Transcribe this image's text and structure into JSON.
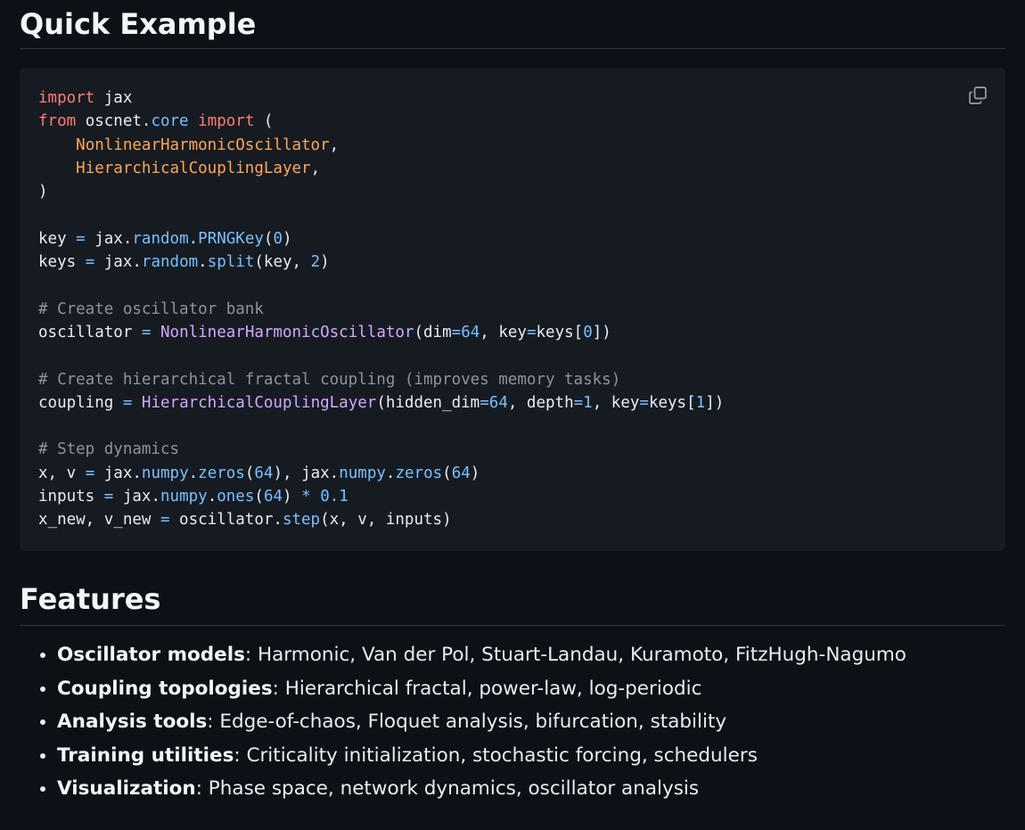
{
  "headings": {
    "quick_example": "Quick Example",
    "features": "Features"
  },
  "code": {
    "language": "python",
    "lines": [
      "import jax",
      "from oscnet.core import (",
      "    NonlinearHarmonicOscillator,",
      "    HierarchicalCouplingLayer,",
      ")",
      "",
      "key = jax.random.PRNGKey(0)",
      "keys = jax.random.split(key, 2)",
      "",
      "# Create oscillator bank",
      "oscillator = NonlinearHarmonicOscillator(dim=64, key=keys[0])",
      "",
      "# Create hierarchical fractal coupling (improves memory tasks)",
      "coupling = HierarchicalCouplingLayer(hidden_dim=64, depth=1, key=keys[1])",
      "",
      "# Step dynamics",
      "x, v = jax.numpy.zeros(64), jax.numpy.zeros(64)",
      "inputs = jax.numpy.ones(64) * 0.1",
      "x_new, v_new = oscillator.step(x, v, inputs)"
    ],
    "copy_icon": "copy-icon"
  },
  "features": [
    {
      "term": "Oscillator models",
      "desc": ": Harmonic, Van der Pol, Stuart-Landau, Kuramoto, FitzHugh-Nagumo"
    },
    {
      "term": "Coupling topologies",
      "desc": ": Hierarchical fractal, power-law, log-periodic"
    },
    {
      "term": "Analysis tools",
      "desc": ": Edge-of-chaos, Floquet analysis, bifurcation, stability"
    },
    {
      "term": "Training utilities",
      "desc": ": Criticality initialization, stochastic forcing, schedulers"
    },
    {
      "term": "Visualization",
      "desc": ": Phase space, network dynamics, oscillator analysis"
    }
  ],
  "colors": {
    "background": "#0d1117",
    "code_background": "#161b22",
    "keyword": "#ff7b72",
    "class": "#ffa657",
    "function": "#d2a8ff",
    "constant": "#79c0ff",
    "comment": "#8b949e"
  }
}
